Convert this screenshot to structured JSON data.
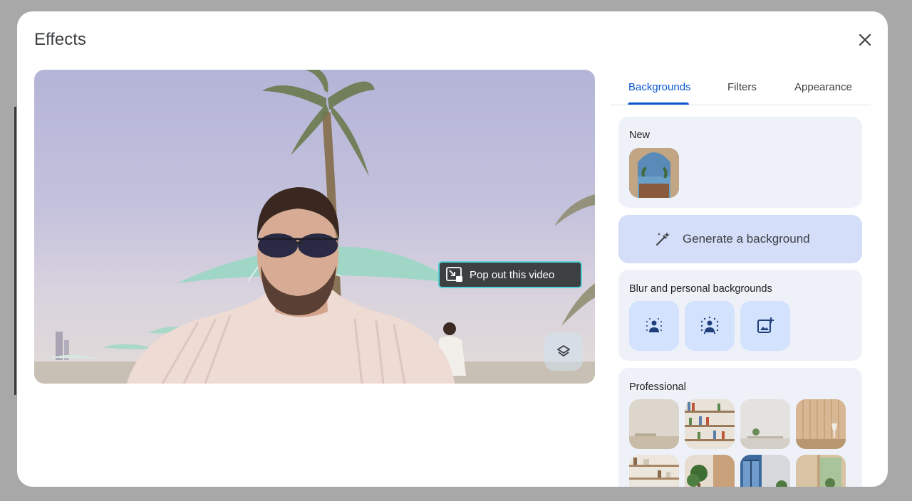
{
  "dialog": {
    "title": "Effects",
    "close_label": "close"
  },
  "video": {
    "popout_tooltip": "Pop out this video"
  },
  "tabs": [
    {
      "label": "Backgrounds",
      "active": true
    },
    {
      "label": "Filters",
      "active": false
    },
    {
      "label": "Appearance",
      "active": false
    }
  ],
  "sections": {
    "new": {
      "title": "New"
    },
    "generate": {
      "label": "Generate a background"
    },
    "blur": {
      "title": "Blur and personal backgrounds",
      "buttons": [
        "slight-blur-icon",
        "blur-icon",
        "add-image-icon"
      ]
    },
    "professional": {
      "title": "Professional"
    }
  },
  "colors": {
    "accent": "#0b57d0",
    "card_bg": "#eef1f8",
    "generate_bg": "#d5def9",
    "blur_btn_bg": "#d3e3fd",
    "tooltip_bg": "#3c4043",
    "tooltip_border": "#5ad1d8"
  }
}
